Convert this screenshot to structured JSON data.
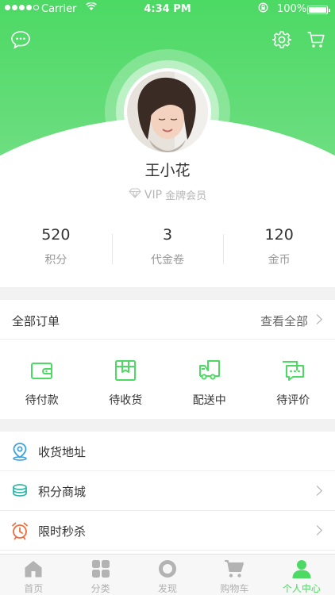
{
  "status_bar": {
    "carrier": "Carrier",
    "time": "4:34 PM",
    "battery": "100%"
  },
  "profile": {
    "name": "王小花",
    "vip_tag": "VIP",
    "vip_level": "金牌会员"
  },
  "stats": [
    {
      "value": "520",
      "label": "积分"
    },
    {
      "value": "3",
      "label": "代金卷"
    },
    {
      "value": "120",
      "label": "金币"
    }
  ],
  "orders": {
    "title": "全部订单",
    "view_all": "查看全部",
    "items": [
      {
        "label": "待付款",
        "icon": "wallet-icon"
      },
      {
        "label": "待收货",
        "icon": "package-icon"
      },
      {
        "label": "配送中",
        "icon": "truck-icon"
      },
      {
        "label": "待评价",
        "icon": "comment-icon"
      }
    ]
  },
  "menu": [
    {
      "label": "收货地址",
      "icon": "location-pin-icon"
    },
    {
      "label": "积分商城",
      "icon": "coins-icon"
    },
    {
      "label": "限时秒杀",
      "icon": "alarm-clock-icon"
    }
  ],
  "tabbar": [
    {
      "label": "首页",
      "icon": "home-icon"
    },
    {
      "label": "分类",
      "icon": "grid-icon"
    },
    {
      "label": "发现",
      "icon": "discover-icon"
    },
    {
      "label": "购物车",
      "icon": "cart-icon"
    },
    {
      "label": "个人中心",
      "icon": "person-icon"
    }
  ],
  "colors": {
    "accent": "#4cd964",
    "alarm": "#f26b3a",
    "pin": "#3aa0e0",
    "coins": "#2fb5a8"
  }
}
